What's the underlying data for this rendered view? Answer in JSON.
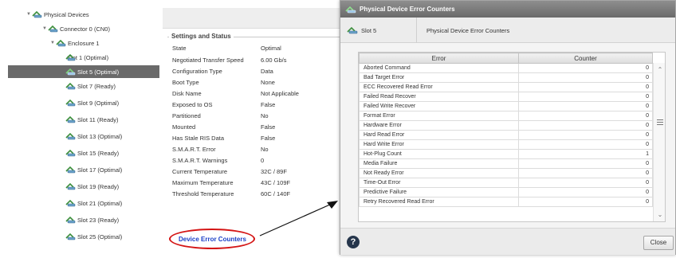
{
  "tree": {
    "root_label": "Physical Devices",
    "connector_label": "Connector 0 (CN0)",
    "enclosure_label": "Enclosure 1",
    "slots": [
      {
        "label": "Slot 1 (Optimal)",
        "selected": false
      },
      {
        "label": "Slot 5 (Optimal)",
        "selected": true
      },
      {
        "label": "Slot 7 (Ready)",
        "selected": false
      },
      {
        "label": "Slot 9 (Optimal)",
        "selected": false
      },
      {
        "label": "Slot 11 (Ready)",
        "selected": false
      },
      {
        "label": "Slot 13 (Optimal)",
        "selected": false
      },
      {
        "label": "Slot 15 (Ready)",
        "selected": false
      },
      {
        "label": "Slot 17 (Optimal)",
        "selected": false
      },
      {
        "label": "Slot 19 (Ready)",
        "selected": false
      },
      {
        "label": "Slot 21 (Optimal)",
        "selected": false
      },
      {
        "label": "Slot 23 (Ready)",
        "selected": false
      },
      {
        "label": "Slot 25 (Optimal)",
        "selected": false
      }
    ]
  },
  "settings": {
    "legend": "Settings and Status",
    "rows": [
      {
        "key": "State",
        "value": "Optimal"
      },
      {
        "key": "Negotiated Transfer Speed",
        "value": "6.00 Gb/s"
      },
      {
        "key": "Configuration Type",
        "value": "Data"
      },
      {
        "key": "Boot Type",
        "value": "None"
      },
      {
        "key": "Disk Name",
        "value": "Not Applicable"
      },
      {
        "key": "Exposed to OS",
        "value": "False"
      },
      {
        "key": "Partitioned",
        "value": "No"
      },
      {
        "key": "Mounted",
        "value": "False"
      },
      {
        "key": "Has Stale RIS Data",
        "value": "False"
      },
      {
        "key": "S.M.A.R.T. Error",
        "value": "No"
      },
      {
        "key": "S.M.A.R.T. Warnings",
        "value": "0"
      },
      {
        "key": "Current Temperature",
        "value": "32C / 89F"
      },
      {
        "key": "Maximum Temperature",
        "value": "43C / 109F"
      },
      {
        "key": "Threshold Temperature",
        "value": "60C / 140F"
      }
    ],
    "link_label": "Device Error Counters"
  },
  "dialog": {
    "title": "Physical Device Error Counters",
    "tab_slot": "Slot 5",
    "tab_heading": "Physical Device Error Counters",
    "columns": [
      "Error",
      "Counter"
    ],
    "rows": [
      {
        "error": "Aborted Command",
        "counter": "0"
      },
      {
        "error": "Bad Target Error",
        "counter": "0"
      },
      {
        "error": "ECC Recovered Read Error",
        "counter": "0"
      },
      {
        "error": "Failed Read Recover",
        "counter": "0"
      },
      {
        "error": "Failed Write Recover",
        "counter": "0"
      },
      {
        "error": "Format Error",
        "counter": "0"
      },
      {
        "error": "Hardware Error",
        "counter": "0"
      },
      {
        "error": "Hard Read Error",
        "counter": "0"
      },
      {
        "error": "Hard Write Error",
        "counter": "0"
      },
      {
        "error": "Hot-Plug Count",
        "counter": "1"
      },
      {
        "error": "Media Failure",
        "counter": "0"
      },
      {
        "error": "Not Ready Error",
        "counter": "0"
      },
      {
        "error": "Time-Out Error",
        "counter": "0"
      },
      {
        "error": "Predictive Failure",
        "counter": "0"
      },
      {
        "error": "Retry Recovered Read Error",
        "counter": "0"
      }
    ],
    "close_label": "Close",
    "help_glyph": "?"
  },
  "colors": {
    "selected_row": "#6a6a6a",
    "link": "#1a3fc7",
    "highlight_oval": "#d41414",
    "titlebar": "#7a7a7a",
    "help_icon": "#25354b"
  }
}
